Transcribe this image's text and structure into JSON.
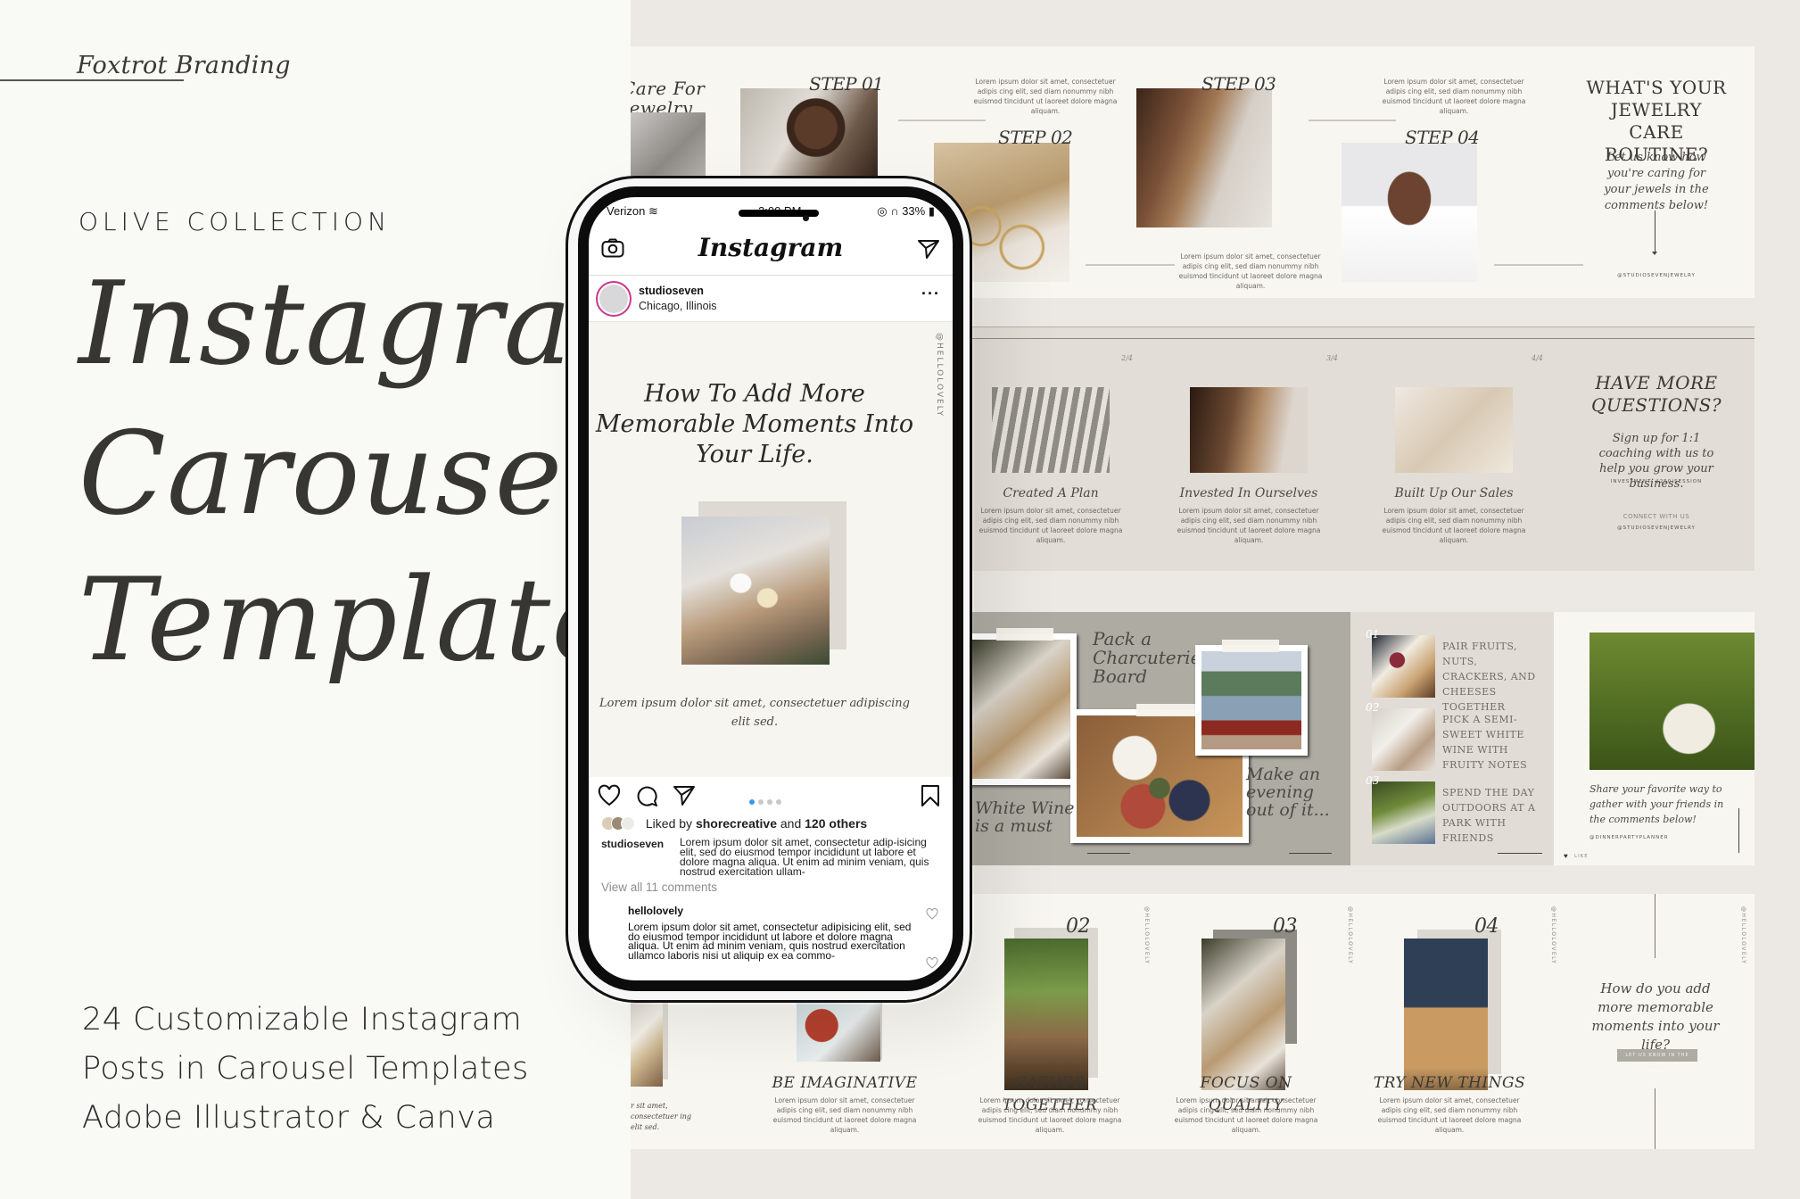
{
  "left": {
    "brand": "Foxtrot Branding",
    "collection": "OLIVE COLLECTION",
    "title_lines": [
      "Instagram",
      "Carousel",
      "Templates"
    ],
    "description_lines": [
      "24 Customizable Instagram",
      "Posts in Carousel Templates",
      "Adobe Illustrator & Canva"
    ]
  },
  "phone": {
    "status": {
      "carrier": "Verizon",
      "time": "2:00 PM",
      "battery": "33%"
    },
    "app_name": "Instagram",
    "post_user": "studioseven",
    "post_location": "Chicago, Illinois",
    "post_title": "How To Add More Memorable Moments Into Your Life.",
    "post_caption": "Lorem ipsum dolor sit amet, consectetuer adipiscing elit sed.",
    "post_handle": "@HELLOLOVELY",
    "carousel": {
      "total": 4,
      "current": 1
    },
    "likes": {
      "prefix": "Liked by",
      "user": "shorecreative",
      "and": "and",
      "others": "120 others"
    },
    "caption_user": "studioseven",
    "caption_text": "Lorem ipsum dolor sit amet, consectetur adip-isicing elit, sed do eiusmod tempor incididunt ut labore et dolore magna aliqua. Ut enim ad minim veniam, quis nostrud exercitation ullam-",
    "view_all": "View all 11 comments",
    "comment_user": "hellolovely",
    "comment_text": "Lorem ipsum dolor sit amet, consectetur adipisicing elit, sed do eiusmod tempor incididunt ut labore et dolore magna aliqua. Ut enim ad minim veniam, quis nostrud exercitation ullamco laboris nisi ut aliquip ex ea commo-"
  },
  "row1": {
    "partial_title": "Care For Jewelry",
    "steps": [
      "STEP 01",
      "STEP 02",
      "STEP 03",
      "STEP 04"
    ],
    "lorem": "Lorem ipsum dolor sit amet, consectetuer adipis cing elit, sed diam nonummy nibh euismod tincidunt ut laoreet dolore magna aliquam.",
    "final_title": "WHAT'S YOUR JEWELRY CARE ROUTINE?",
    "final_text": "Let us know how you're caring for your jewels in the comments below!",
    "handle": "@STUDIOSEVENJEWELRY"
  },
  "row2": {
    "pages": [
      "2/4",
      "3/4",
      "4/4"
    ],
    "items": [
      {
        "title": "Created A Plan"
      },
      {
        "title": "Invested In Ourselves"
      },
      {
        "title": "Built Up Our Sales"
      }
    ],
    "lorem": "Lorem ipsum dolor sit amet, consectetuer adipis cing elit, sed diam nonummy nibh euismod tincidunt ut laoreet dolore magna aliquam.",
    "final_title": "HAVE MORE QUESTIONS?",
    "final_text": "Sign up for 1:1 coaching with us to help you grow your business.",
    "investment": "INVESTMENT: $250/SESSION",
    "connect": "CONNECT WITH US",
    "handle": "@STUDIOSEVENJEWELRY"
  },
  "row3": {
    "charcuterie": "Pack a Charcuterie Board",
    "white_wine": "White Wine is a must",
    "evening": "Make an evening out of it...",
    "tips": [
      {
        "num": "01",
        "text": "PAIR FRUITS, NUTS, CRACKERS, AND CHEESES TOGETHER"
      },
      {
        "num": "02",
        "text": "PICK A SEMI-SWEET WHITE WINE WITH FRUITY NOTES"
      },
      {
        "num": "03",
        "text": "SPEND THE DAY OUTDOORS AT A PARK WITH FRIENDS"
      }
    ],
    "share_text": "Share your favorite way to gather with your friends in the comments below!",
    "handle": "@DINNERPARTYPLANNER",
    "like": "LIKE"
  },
  "row4": {
    "partial_caption": "r sit amet, consectetuer ing elit sed.",
    "items": [
      {
        "num": "",
        "title": "BE IMAGINATIVE"
      },
      {
        "num": "02",
        "title": "GATHER TOGETHER"
      },
      {
        "num": "03",
        "title": "FOCUS ON QUALITY"
      },
      {
        "num": "04",
        "title": "TRY NEW THINGS"
      }
    ],
    "lorem": "Lorem ipsum dolor sit amet, consectetuer adipis cing elit, sed diam nonummy nibh euismod tincidunt ut laoreet dolore magna aliquam.",
    "handle": "@HELLOLOVELY",
    "final_text": "How do you add more memorable moments into your life?",
    "cta": "LET US KNOW IN THE COMMENTS!"
  }
}
